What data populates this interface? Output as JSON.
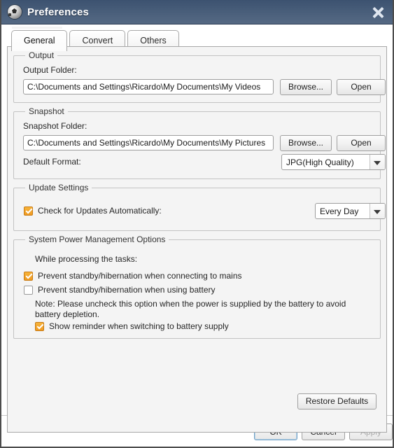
{
  "window": {
    "title": "Preferences",
    "icon": "app-sphere-icon",
    "close_icon": "close-icon",
    "titlebar_color": "#4a5f7b",
    "background_color": "#f4f4f4",
    "accent_color": "#ef9a21"
  },
  "tabs": [
    {
      "label": "General",
      "selected": true
    },
    {
      "label": "Convert",
      "selected": false
    },
    {
      "label": "Others",
      "selected": false
    }
  ],
  "output": {
    "legend": "Output",
    "folder_label": "Output Folder:",
    "folder_value": "C:\\Documents and Settings\\Ricardo\\My Documents\\My Videos",
    "browse_label": "Browse...",
    "open_label": "Open"
  },
  "snapshot": {
    "legend": "Snapshot",
    "folder_label": "Snapshot Folder:",
    "folder_value": "C:\\Documents and Settings\\Ricardo\\My Documents\\My Pictures",
    "browse_label": "Browse...",
    "open_label": "Open",
    "format_label": "Default Format:",
    "format_value": "JPG(High Quality)"
  },
  "update": {
    "legend": "Update Settings",
    "check_label": "Check for Updates Automatically:",
    "check_checked": true,
    "interval_value": "Every Day"
  },
  "power": {
    "legend": "System Power Management Options",
    "intro": "While processing the tasks:",
    "mains_label": "Prevent standby/hibernation when connecting to mains",
    "mains_checked": true,
    "battery_label": "Prevent standby/hibernation when using battery",
    "battery_checked": false,
    "note": "Note: Please uncheck this option when the power is supplied by the battery to avoid battery depletion.",
    "reminder_label": "Show reminder when switching to battery supply",
    "reminder_checked": true
  },
  "actions": {
    "restore_defaults": "Restore Defaults",
    "ok": "OK",
    "cancel": "Cancel",
    "apply": "Apply",
    "apply_disabled": true
  }
}
